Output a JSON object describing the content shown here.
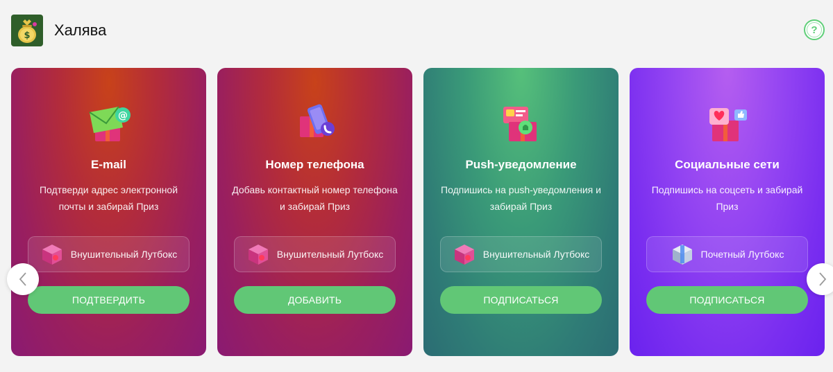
{
  "header": {
    "title": "Халява",
    "help_symbol": "?",
    "logo_icon": "money-bag-icon"
  },
  "cards": [
    {
      "title": "E-mail",
      "description": "Подтверди адрес электронной почты и забирай Приз",
      "prize": "Внушительный Лутбокс",
      "action": "ПОДТВЕРДИТЬ",
      "icon": "email-gift-icon"
    },
    {
      "title": "Номер телефона",
      "description": "Добавь контактный номер телефона и забирай Приз",
      "prize": "Внушительный Лутбокс",
      "action": "ДОБАВИТЬ",
      "icon": "phone-gift-icon"
    },
    {
      "title": "Push-уведомление",
      "description": "Подпишись на push-уведомления и забирай Приз",
      "prize": "Внушительный Лутбокс",
      "action": "ПОДПИСАТЬСЯ",
      "icon": "notification-gift-icon"
    },
    {
      "title": "Социальные сети",
      "description": "Подпишись на соцсеть и забирай Приз",
      "prize": "Почетный Лутбокс",
      "action": "ПОДПИСАТЬСЯ",
      "icon": "social-gift-icon"
    }
  ],
  "colors": {
    "accent_green": "#61c776",
    "card_red": "#b32c3a",
    "card_teal": "#3a9a78",
    "card_purple": "#9445f2"
  }
}
